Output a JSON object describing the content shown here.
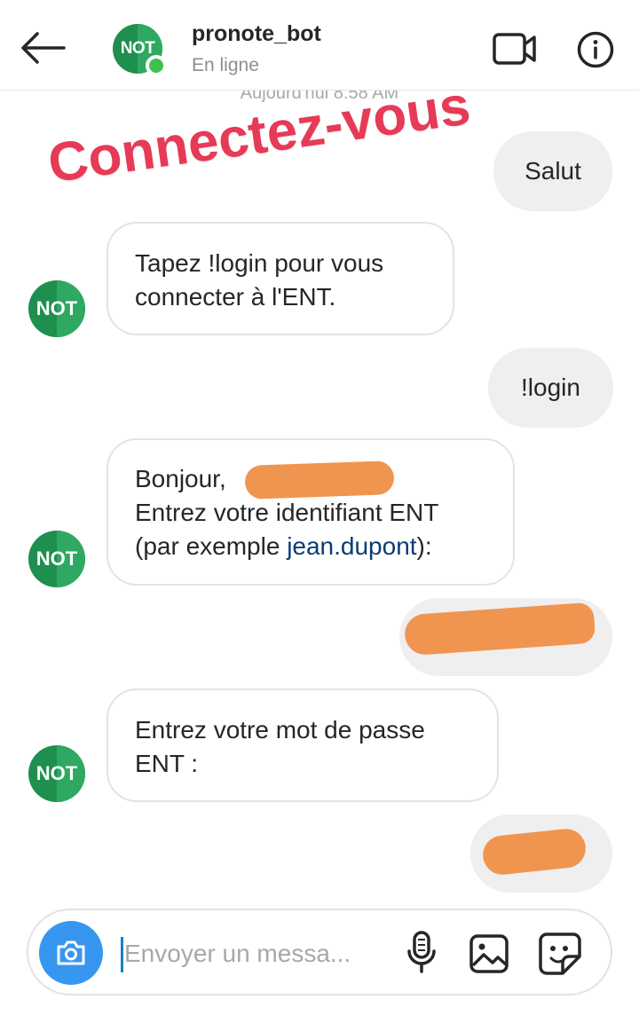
{
  "header": {
    "contact_name": "pronote_bot",
    "status": "En ligne",
    "avatar_text": "NOT"
  },
  "conversation": {
    "timestamp": "Aujourd'hui 8:58 AM",
    "sticker_text": "Connectez-vous",
    "messages": [
      {
        "direction": "outgoing",
        "text": "Salut"
      },
      {
        "direction": "incoming",
        "lines": [
          "Tapez !login pour vous",
          "connecter à l'ENT."
        ]
      },
      {
        "direction": "outgoing",
        "text": "!login"
      },
      {
        "direction": "incoming",
        "line1": "Bonjour,",
        "line2": "Entrez votre identifiant ENT",
        "line3_prefix": "(par exemple ",
        "line3_link": "jean.dupont",
        "line3_suffix": "):"
      },
      {
        "direction": "outgoing",
        "text": ""
      },
      {
        "direction": "incoming",
        "lines": [
          "Entrez votre mot de passe",
          "ENT :"
        ]
      },
      {
        "direction": "outgoing",
        "text": ""
      }
    ],
    "bot_avatar_text": "NOT"
  },
  "composer": {
    "placeholder": "Envoyer un messa..."
  },
  "colors": {
    "bot_green_dark": "#1e8f4e",
    "bot_green_light": "#2fa862",
    "online_green": "#3ec24a",
    "sticker_red": "#e63a56",
    "camera_blue": "#3797f0",
    "link_blue": "#0a3b76",
    "redaction_orange": "#f0954f"
  },
  "icons": [
    "back-arrow-icon",
    "video-call-icon",
    "info-icon",
    "camera-icon",
    "microphone-icon",
    "image-gallery-icon",
    "sticker-icon"
  ]
}
